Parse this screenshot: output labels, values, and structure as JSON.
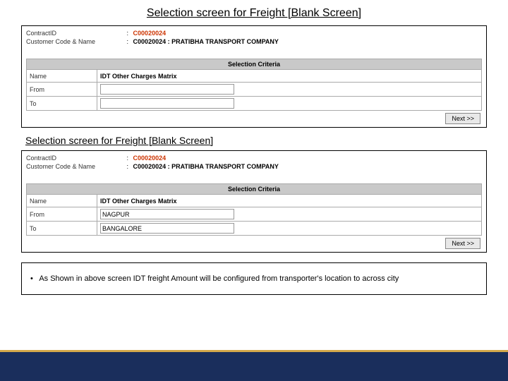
{
  "title_main": "Selection screen for Freight [Blank Screen]",
  "title_sub": "Selection screen for Freight [Blank Screen]",
  "box1": {
    "contract_label": "ContractID",
    "contract_value": "C00020024",
    "cust_label": "Customer Code & Name",
    "cust_value": "C00020024 : PRATIBHA TRANSPORT COMPANY",
    "criteria_heading": "Selection Criteria",
    "name_label": "Name",
    "name_value": "IDT Other Charges Matrix",
    "from_label": "From",
    "from_value": "",
    "to_label": "To",
    "to_value": "",
    "next_label": "Next >>"
  },
  "box2": {
    "contract_label": "ContractID",
    "contract_value": "C00020024",
    "cust_label": "Customer Code & Name",
    "cust_value": "C00020024 : PRATIBHA TRANSPORT COMPANY",
    "criteria_heading": "Selection Criteria",
    "name_label": "Name",
    "name_value": "IDT Other Charges Matrix",
    "from_label": "From",
    "from_value": "NAGPUR",
    "to_label": "To",
    "to_value": "BANGALORE",
    "next_label": "Next >>"
  },
  "bullet_text": "As Shown in above screen IDT freight Amount will be configured from transporter's  location to across city"
}
